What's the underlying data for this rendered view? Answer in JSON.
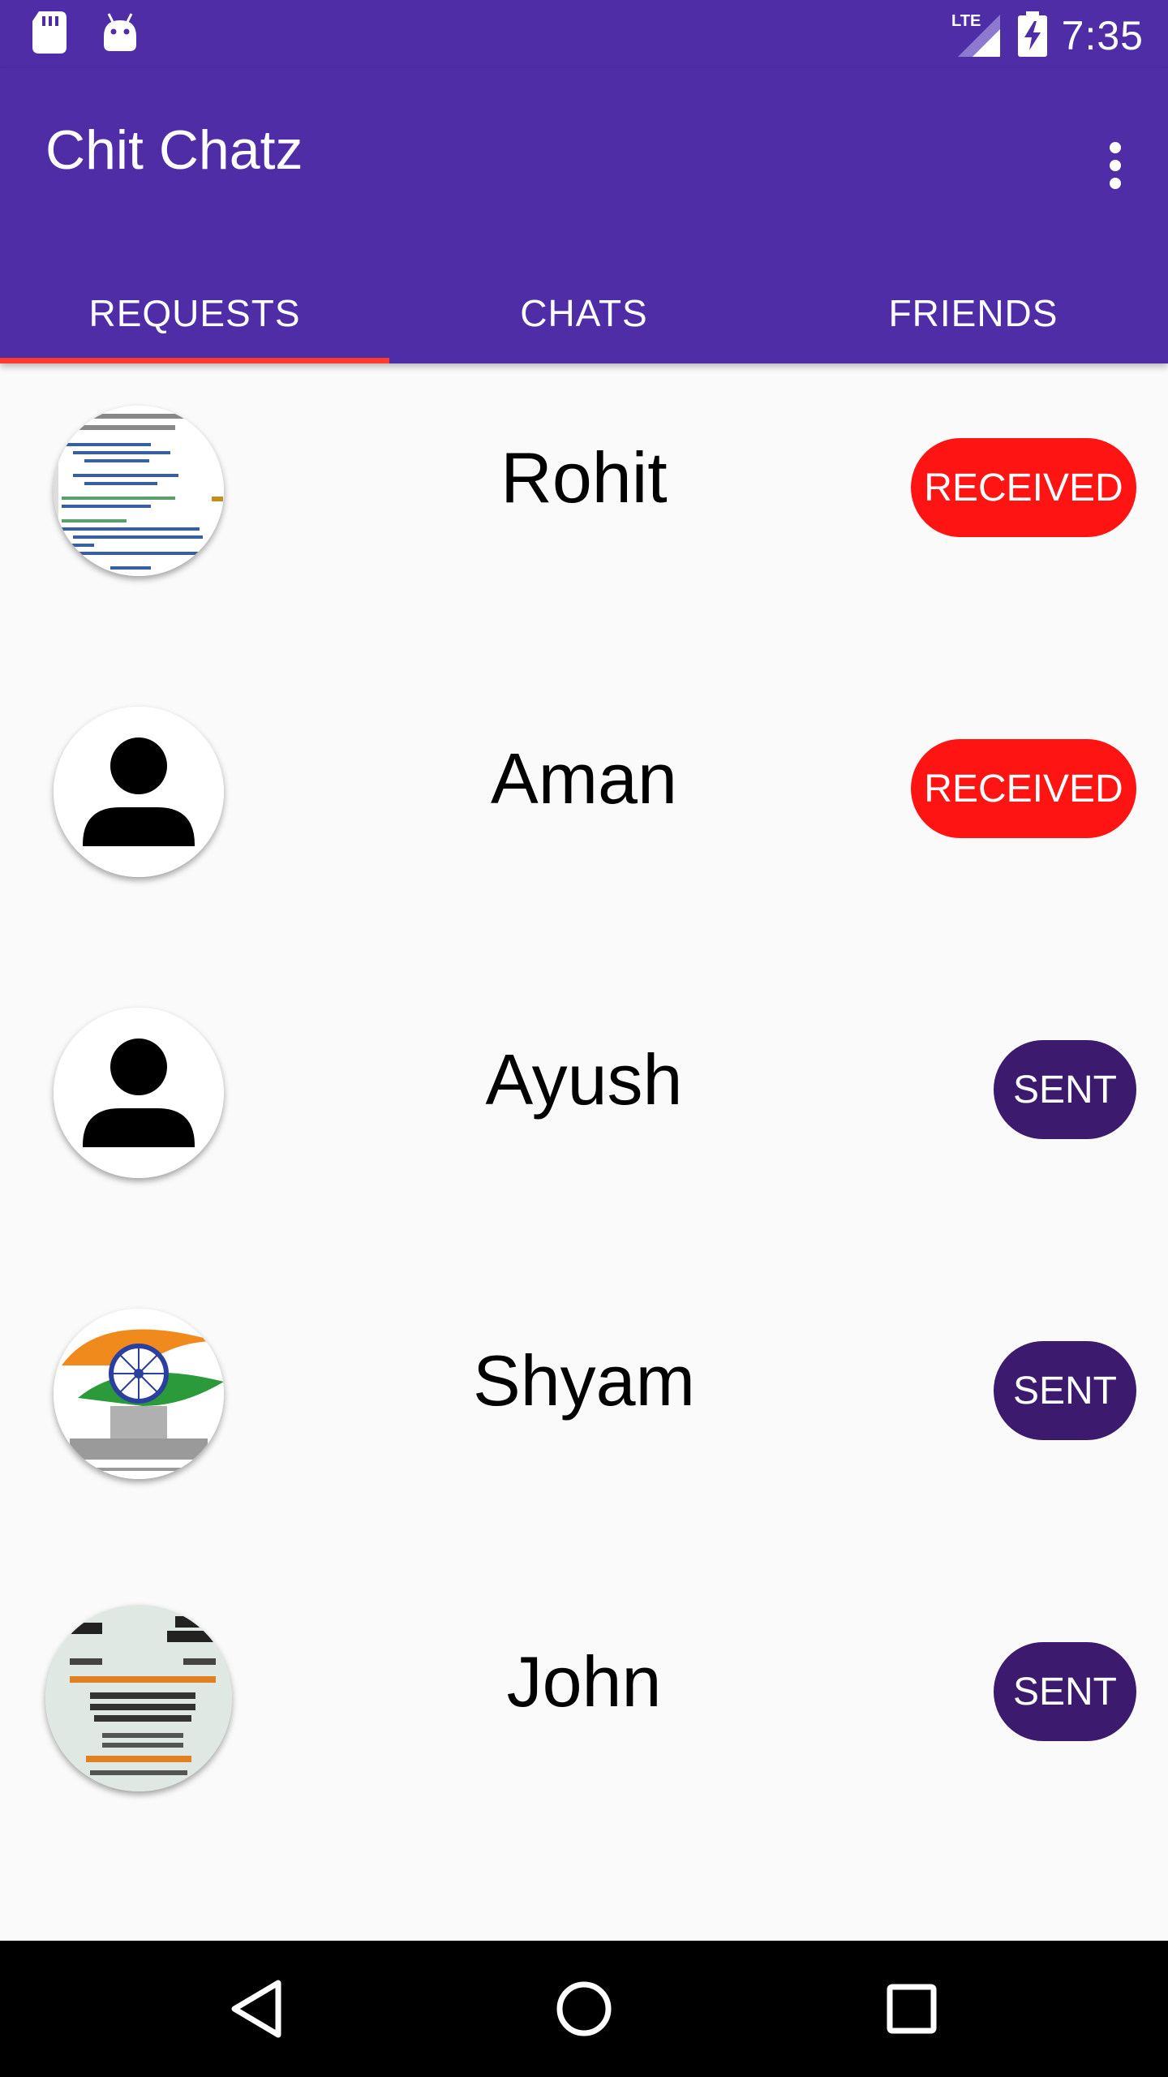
{
  "status_bar": {
    "network": "LTE",
    "time": "7:35"
  },
  "app_bar": {
    "title": "Chit Chatz"
  },
  "tabs": [
    {
      "label": "REQUESTS",
      "selected": true
    },
    {
      "label": "CHATS",
      "selected": false
    },
    {
      "label": "FRIENDS",
      "selected": false
    }
  ],
  "requests": [
    {
      "name": "Rohit",
      "status": "RECEIVED",
      "avatar": "code-screenshot-image"
    },
    {
      "name": "Aman",
      "status": "RECEIVED",
      "avatar": "default-person-icon"
    },
    {
      "name": "Ayush",
      "status": "SENT",
      "avatar": "default-person-icon"
    },
    {
      "name": "Shyam",
      "status": "SENT",
      "avatar": "republic-day-image"
    },
    {
      "name": "John",
      "status": "SENT",
      "avatar": "course-poster-image"
    }
  ],
  "colors": {
    "primary": "#4f2da7",
    "received": "#ff1414",
    "sent": "#3c1a6e",
    "tab_indicator": "#ff3b30"
  }
}
